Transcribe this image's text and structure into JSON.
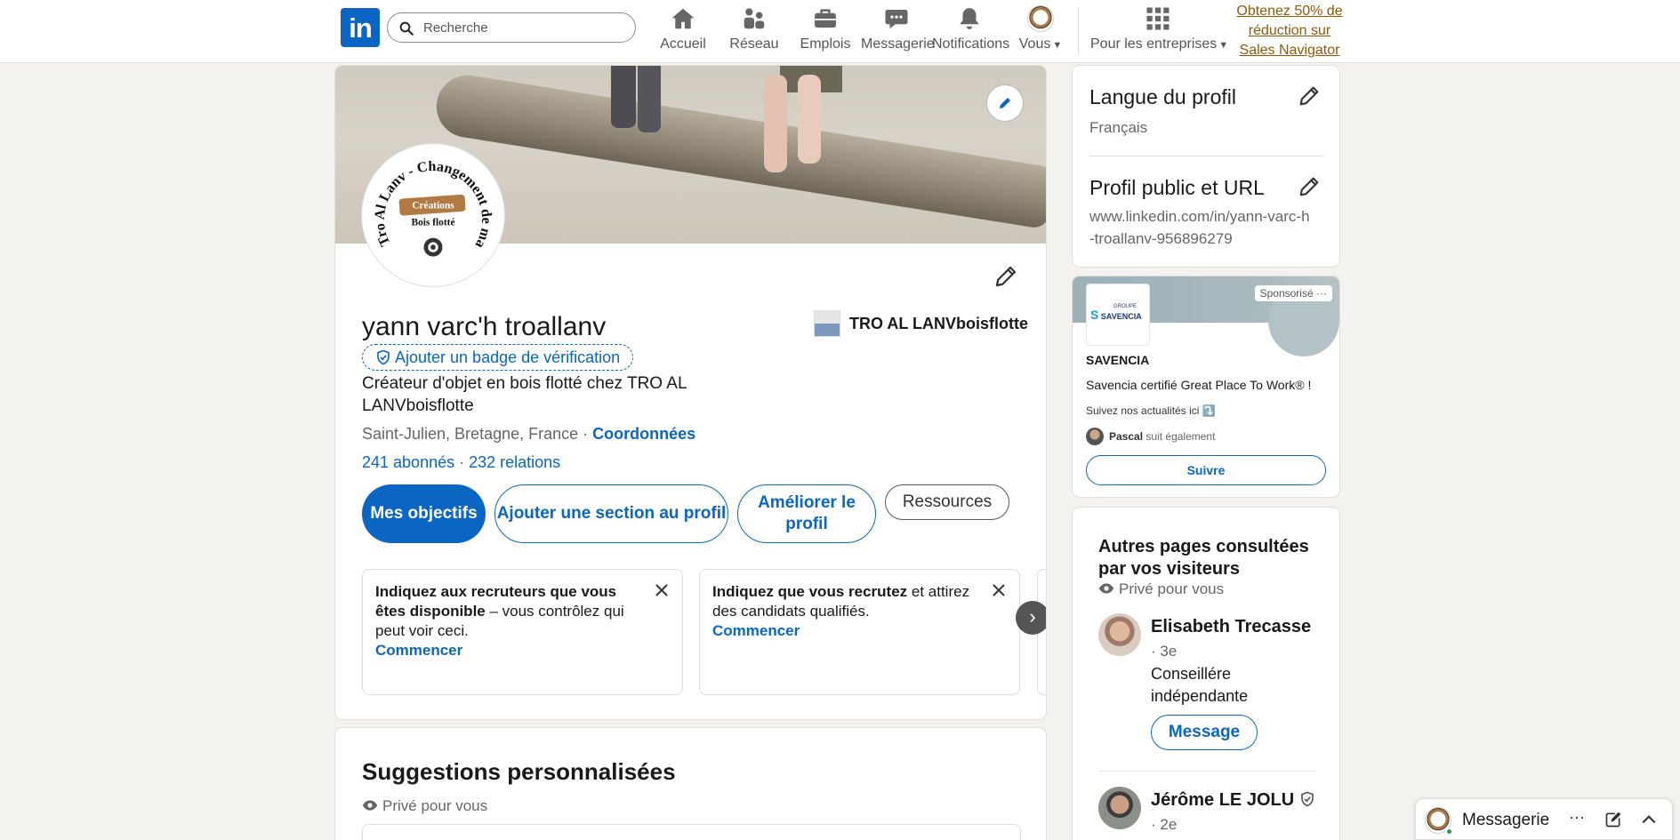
{
  "nav": {
    "logo": "in",
    "search_placeholder": "Recherche",
    "items": [
      {
        "label": "Accueil",
        "icon": "home-icon"
      },
      {
        "label": "Réseau",
        "icon": "network-icon"
      },
      {
        "label": "Emplois",
        "icon": "briefcase-icon"
      },
      {
        "label": "Messagerie",
        "icon": "chat-icon"
      },
      {
        "label": "Notifications",
        "icon": "bell-icon"
      },
      {
        "label": "Vous",
        "icon": "avatar"
      }
    ],
    "business": "Pour les entreprises",
    "promo": "Obtenez 50% de réduction sur Sales Navigator"
  },
  "profile": {
    "name": "yann varc'h troallanv",
    "verify_badge": "Ajouter un badge de vérification",
    "headline": "Créateur d'objet en bois flotté chez TRO AL LANVboisflotte",
    "location": "Saint-Julien, Bretagne, France · ",
    "contact_link": "Coordonnées",
    "followers": "241 abonnés",
    "connections": "232 relations",
    "separator": " · ",
    "company": "TRO AL LANVboisflotte",
    "photo_text": {
      "arc": "Tro Al Lanv - Changement de marée",
      "line1": "Créations",
      "line2": "Bois flotté"
    },
    "buttons": {
      "goals": "Mes objectifs",
      "add_section": "Ajouter une section au profil",
      "improve": "Améliorer le profil",
      "resources": "Ressources"
    },
    "suggestions": [
      {
        "bold": "Indiquez aux recruteurs que vous êtes disponible",
        "rest": " – vous contrôlez qui peut voir ceci.",
        "action": "Commencer"
      },
      {
        "bold": "Indiquez que vous recrutez",
        "rest": " et attirez des candidats qualifiés.",
        "action": "Commencer"
      }
    ],
    "carousel_next": "›"
  },
  "personalized": {
    "title": "Suggestions personnalisées",
    "private": "Privé pour vous"
  },
  "right": {
    "lang_title": "Langue du profil",
    "lang_value": "Français",
    "url_title": "Profil public et URL",
    "url_value": "www.linkedin.com/in/yann-varc-h-troallanv-956896279"
  },
  "ad": {
    "sponsored": "Sponsorisé",
    "more": "···",
    "logo_top": "GROUPE",
    "logo_name": "SAVENCIA",
    "company": "SAVENCIA",
    "text": "Savencia certifié Great Place To Work® !",
    "text2": "Suivez nos actualités ici ⤵️",
    "follower_name": "Pascal",
    "follower_text": " suit également",
    "follow_btn": "Suivre"
  },
  "visitors": {
    "title": "Autres pages consultées par vos visiteurs",
    "private": "Privé pour vous",
    "people": [
      {
        "name": "Elisabeth Trecasse",
        "degree": "· 3e",
        "job": "Conseillére indépendante",
        "action": "Message"
      },
      {
        "name": "Jérôme LE JOLU",
        "degree": "· 2e"
      }
    ]
  },
  "messaging": {
    "label": "Messagerie",
    "more": "···"
  },
  "colors": {
    "brand": "#0a66c2",
    "promo": "#915907",
    "background": "#f4f2ee"
  }
}
